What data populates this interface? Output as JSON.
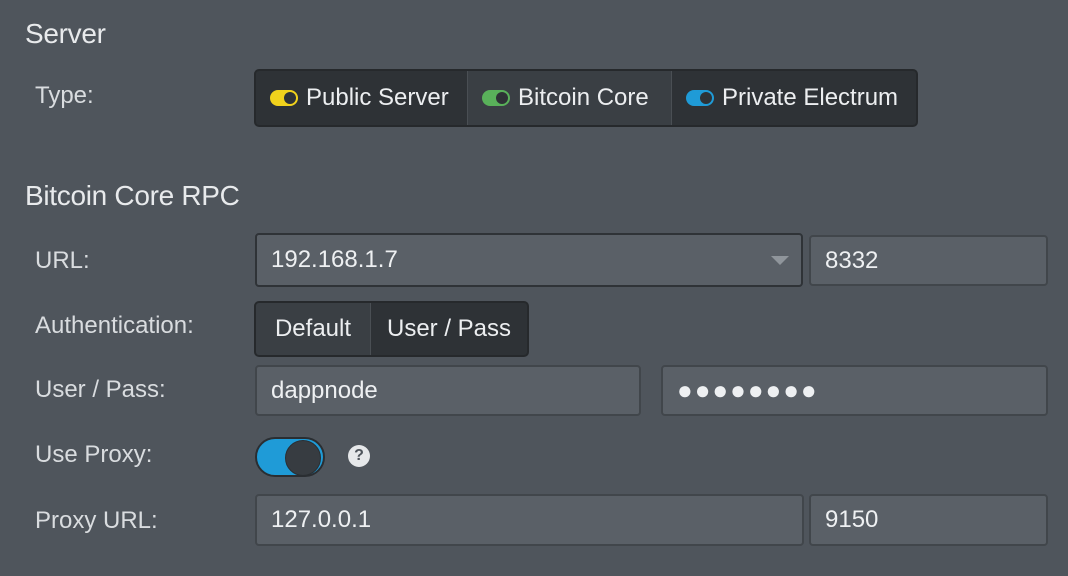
{
  "server": {
    "title": "Server",
    "type_label": "Type:",
    "types": [
      {
        "label": "Public Server",
        "color": "#f1d21c"
      },
      {
        "label": "Bitcoin Core",
        "color": "#59b15a",
        "selected": true
      },
      {
        "label": "Private Electrum",
        "color": "#1f9bd7"
      }
    ]
  },
  "rpc": {
    "title": "Bitcoin Core RPC",
    "url_label": "URL:",
    "url_host": "192.168.1.7",
    "url_port": "8332",
    "auth_label": "Authentication:",
    "auth_options": [
      "Default",
      "User / Pass"
    ],
    "auth_selected": "User / Pass",
    "userpass_label": "User / Pass:",
    "user": "dappnode",
    "pass": "●●●●●●●●",
    "proxy_label": "Use Proxy:",
    "proxy_enabled": true,
    "proxy_help": "?",
    "proxy_url_label": "Proxy URL:",
    "proxy_host": "127.0.0.1",
    "proxy_port": "9150"
  }
}
